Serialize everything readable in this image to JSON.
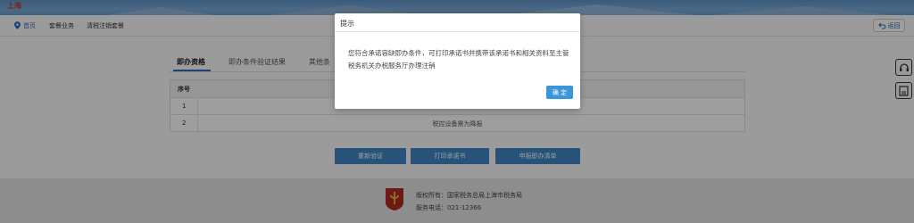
{
  "header": {
    "logo_text": "上海"
  },
  "breadcrumb": {
    "items": [
      "首页",
      "套餐业务",
      "清税注销套餐"
    ]
  },
  "back_button": {
    "label": "返回"
  },
  "tabs": [
    {
      "label": "即办资格"
    },
    {
      "label": "即办条件验证结果"
    },
    {
      "label": "其他条"
    }
  ],
  "table": {
    "header_no": "序号",
    "rows": [
      {
        "no": "1",
        "text": ""
      },
      {
        "no": "2",
        "text": "税控设备需为降报"
      }
    ]
  },
  "actions": {
    "reverify": "重新验证",
    "print": "打印承诺书",
    "apply": "申报即办清单"
  },
  "footer": {
    "copyright": "版权所有：国家税务总局上海市税务局",
    "hotline": "服务电话：021-12366"
  },
  "modal": {
    "title": "提示",
    "message": "您符合承诺容缺即办条件，可打印承诺书并携带该承诺书和相关资料至主管税务机关办税服务厅办理注销",
    "ok": "确 定"
  },
  "colors": {
    "primary": "#3f86c6",
    "banner": "#6d9fce",
    "modal_ok": "#3b95d9"
  }
}
